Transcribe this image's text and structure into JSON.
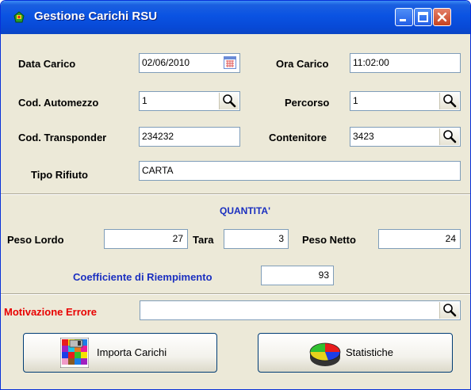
{
  "window": {
    "title": "Gestione Carichi RSU"
  },
  "form": {
    "data_carico_label": "Data Carico",
    "data_carico_value": "02/06/2010",
    "ora_carico_label": "Ora Carico",
    "ora_carico_value": "11:02:00",
    "cod_automezzo_label": "Cod. Automezzo",
    "cod_automezzo_value": "1",
    "percorso_label": "Percorso",
    "percorso_value": "1",
    "cod_transponder_label": "Cod. Transponder",
    "cod_transponder_value": "234232",
    "contenitore_label": "Contenitore",
    "contenitore_value": "3423",
    "tipo_rifiuto_label": "Tipo Rifiuto",
    "tipo_rifiuto_value": "CARTA"
  },
  "quantita": {
    "heading": "QUANTITA'",
    "peso_lordo_label": "Peso Lordo",
    "peso_lordo_value": "27",
    "tara_label": "Tara",
    "tara_value": "3",
    "peso_netto_label": "Peso Netto",
    "peso_netto_value": "24",
    "coefficiente_label": "Coefficiente di Riempimento",
    "coefficiente_value": "93"
  },
  "errore": {
    "motivazione_label": "Motivazione Errore",
    "motivazione_value": ""
  },
  "buttons": {
    "importa_label": "Importa Carichi",
    "statistiche_label": "Statistiche"
  },
  "colors": {
    "title_bar": "#0a53e2",
    "window_bg": "#ece9d8",
    "section_heading": "#1a2fc0",
    "error_label": "#e80000"
  },
  "icons": [
    "app-icon",
    "minimize-icon",
    "maximize-icon",
    "close-icon",
    "calendar-icon",
    "magnifier-icon",
    "import-icon",
    "pie-chart-icon"
  ]
}
